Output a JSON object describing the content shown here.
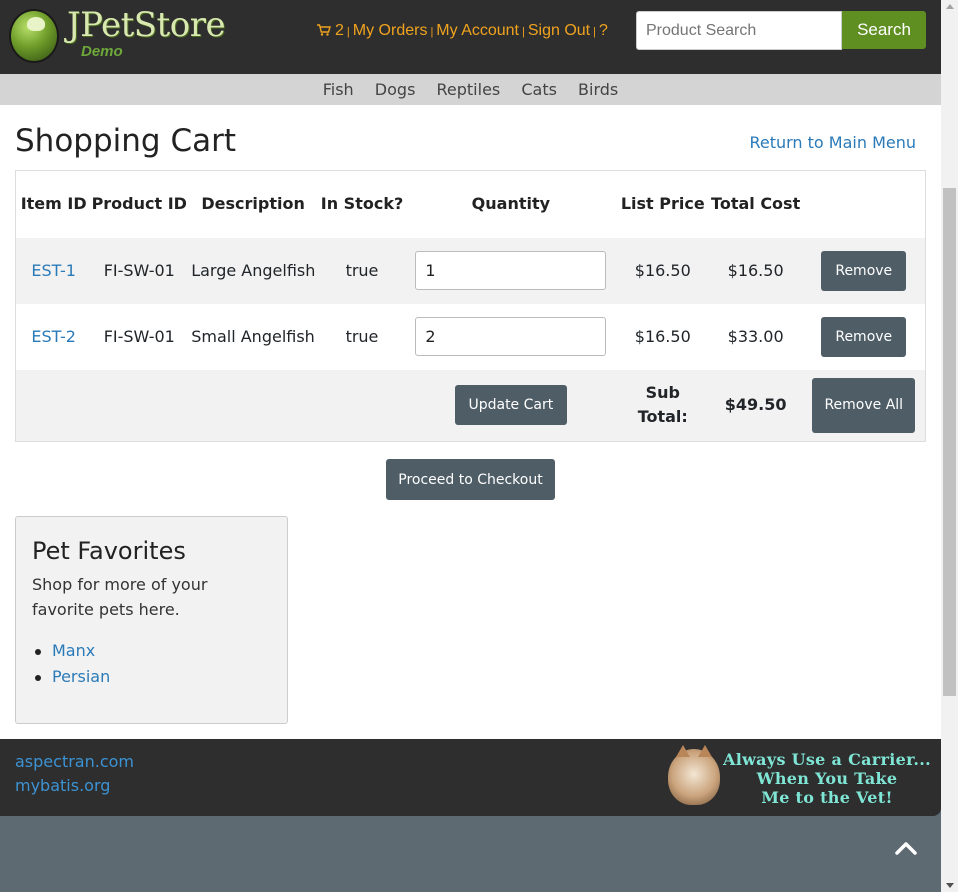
{
  "header": {
    "logo_title": "JPetStore",
    "logo_subtitle": "Demo",
    "cart_count": "2",
    "nav": [
      {
        "label": "My Orders"
      },
      {
        "label": "My Account"
      },
      {
        "label": "Sign Out"
      },
      {
        "label": "?"
      }
    ],
    "search": {
      "placeholder": "Product Search",
      "value": "",
      "button_label": "Search"
    }
  },
  "categories": [
    "Fish",
    "Dogs",
    "Reptiles",
    "Cats",
    "Birds"
  ],
  "main": {
    "title": "Shopping Cart",
    "return_link": "Return to Main Menu",
    "table": {
      "headers": {
        "item_id": "Item ID",
        "product_id": "Product ID",
        "description": "Description",
        "in_stock": "In Stock?",
        "quantity": "Quantity",
        "list_price": "List Price",
        "total_cost": "Total Cost"
      },
      "rows": [
        {
          "item_id": "EST-1",
          "product_id": "FI-SW-01",
          "description": "Large Angelfish",
          "in_stock": "true",
          "quantity": "1",
          "list_price": "$16.50",
          "total_cost": "$16.50",
          "remove_label": "Remove"
        },
        {
          "item_id": "EST-2",
          "product_id": "FI-SW-01",
          "description": "Small Angelfish",
          "in_stock": "true",
          "quantity": "2",
          "list_price": "$16.50",
          "total_cost": "$33.00",
          "remove_label": "Remove"
        }
      ],
      "update_label": "Update Cart",
      "subtotal_label": "Sub Total:",
      "subtotal_value": "$49.50",
      "remove_all_label": "Remove All"
    },
    "checkout_label": "Proceed to Checkout"
  },
  "favorites": {
    "title": "Pet Favorites",
    "text": "Shop for more of your favorite pets here.",
    "items": [
      "Manx",
      "Persian"
    ]
  },
  "footer": {
    "links": [
      "aspectran.com",
      "mybatis.org"
    ],
    "banner_lines": [
      "Always Use a Carrier...",
      "When You Take",
      "Me to the Vet!"
    ]
  },
  "colors": {
    "header_bg": "#2e2e2e",
    "accent_orange": "#f0a31e",
    "search_green": "#5f8f21",
    "button_slate": "#4e5d66",
    "link_blue": "#2a7ab8"
  }
}
